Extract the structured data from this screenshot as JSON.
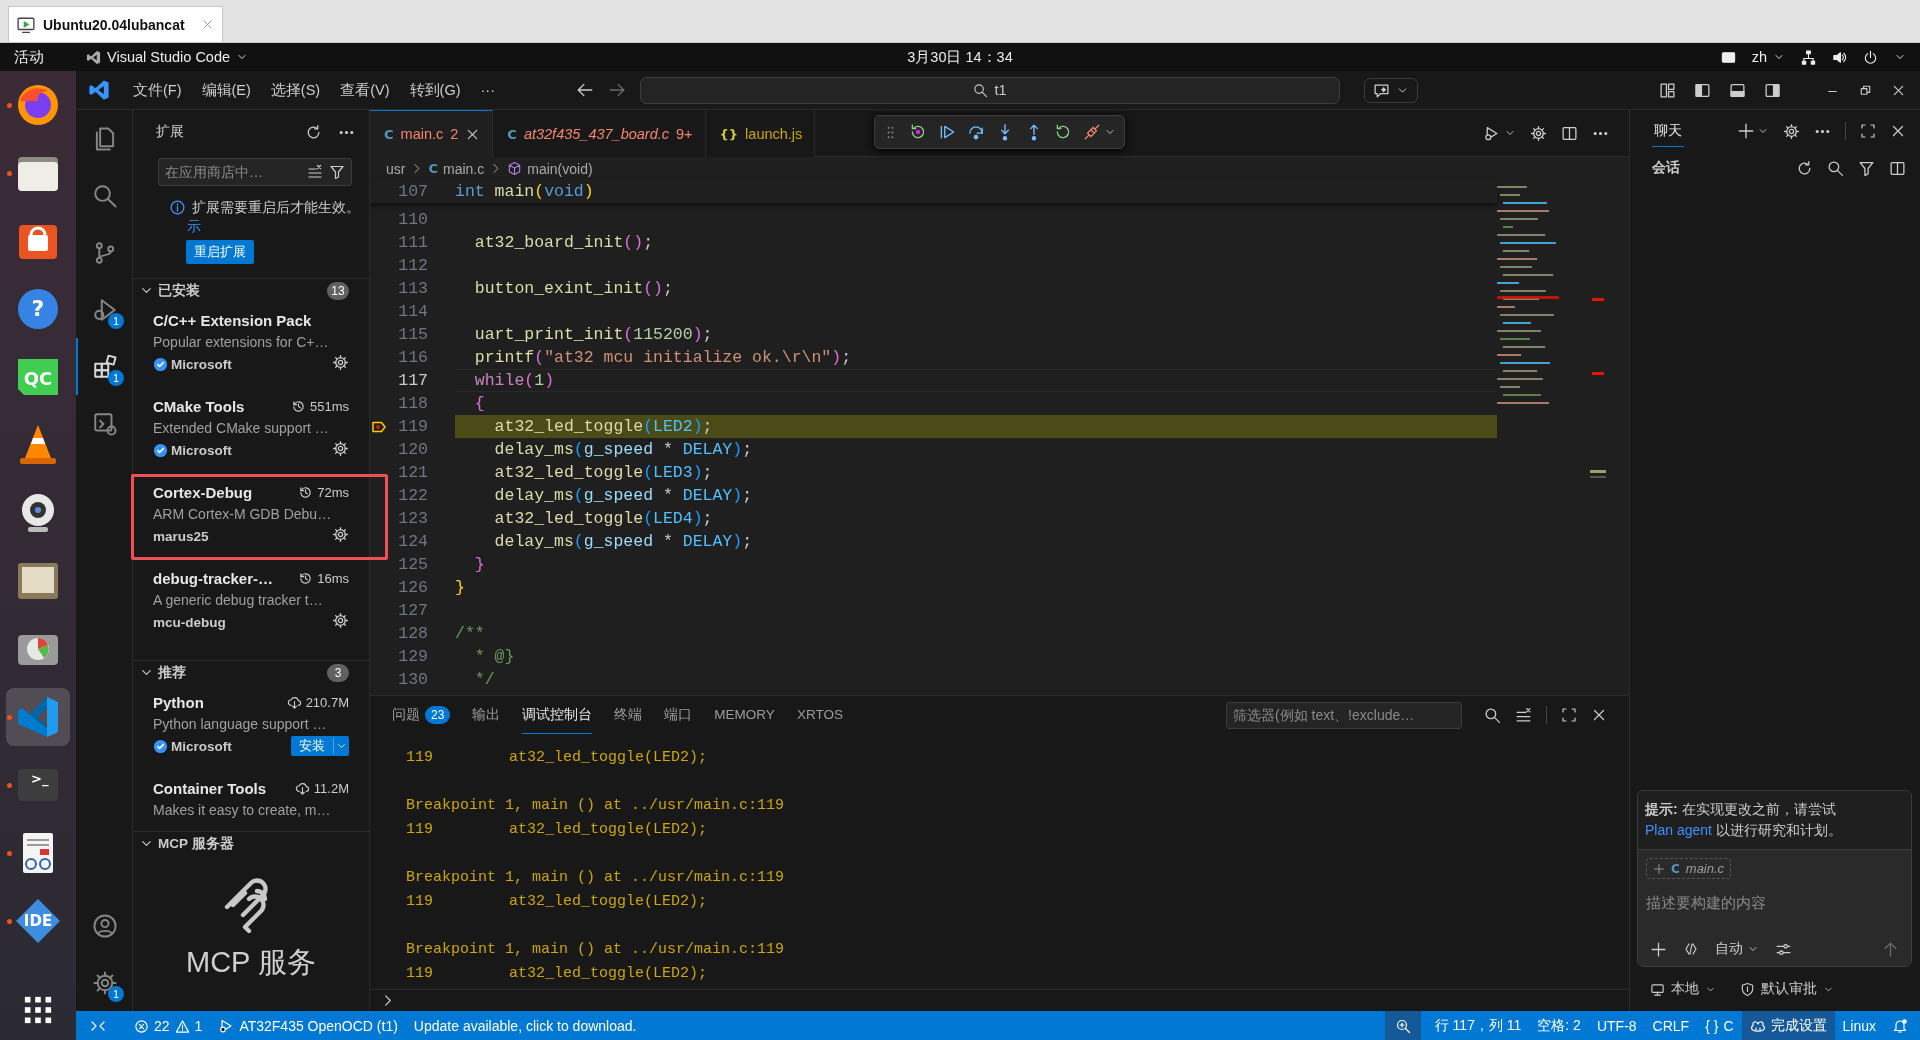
{
  "vm_tab": {
    "title": "Ubuntu20.04lubancat"
  },
  "top_bar": {
    "activities": "活动",
    "app": "Visual Studio Code",
    "clock": "3月30日 14：34",
    "input_method": "zh"
  },
  "dock": {
    "items": [
      {
        "kind": "browser",
        "running": true,
        "selected": false
      },
      {
        "kind": "files",
        "running": true,
        "selected": false
      },
      {
        "kind": "store",
        "running": false,
        "selected": false
      },
      {
        "kind": "help",
        "label": "?",
        "running": false,
        "selected": false
      },
      {
        "kind": "qc",
        "label": "QC",
        "running": false,
        "selected": false
      },
      {
        "kind": "cone",
        "running": false,
        "selected": false
      },
      {
        "kind": "webcam",
        "running": false,
        "selected": false
      },
      {
        "kind": "drawer",
        "running": false,
        "selected": false
      },
      {
        "kind": "disk",
        "running": false,
        "selected": false
      },
      {
        "kind": "code",
        "running": true,
        "selected": true
      },
      {
        "kind": "terminal",
        "label": ">_",
        "running": true,
        "selected": false
      },
      {
        "kind": "viewer",
        "running": true,
        "selected": false
      },
      {
        "kind": "ide",
        "label": "IDE",
        "running": true,
        "selected": false
      }
    ]
  },
  "title_bar": {
    "menus": [
      "文件(F)",
      "编辑(E)",
      "选择(S)",
      "查看(V)",
      "转到(G)",
      "···"
    ],
    "search": "t1"
  },
  "activity_bar": {
    "items": [
      {
        "kind": "explorer",
        "selected": false
      },
      {
        "kind": "search",
        "selected": false
      },
      {
        "kind": "source-control",
        "selected": false
      },
      {
        "kind": "debug",
        "badge": "1",
        "selected": false
      },
      {
        "kind": "extensions",
        "badge": "1",
        "selected": true
      },
      {
        "kind": "remote",
        "selected": false
      }
    ],
    "bottom": [
      {
        "kind": "account"
      },
      {
        "kind": "settings",
        "badge": "1"
      }
    ]
  },
  "sidebar": {
    "title": "扩展",
    "search": {
      "placeholder": "在应用商店中…"
    },
    "notice": {
      "text": "扩展需要重启后才能生效。",
      "link": "示",
      "button": "重启扩展"
    },
    "sections": [
      {
        "title": "已安装",
        "count": "13",
        "expanded": true,
        "items": [
          {
            "name": "C/C++ Extension Pack",
            "description": "Popular extensions for C+…",
            "publisher": "Microsoft",
            "verified": true,
            "highlighted": false
          },
          {
            "name": "CMake Tools",
            "metric": {
              "kind": "startup",
              "text": "551ms"
            },
            "description": "Extended CMake support …",
            "publisher": "Microsoft",
            "verified": true,
            "highlighted": false
          },
          {
            "name": "Cortex-Debug",
            "metric": {
              "kind": "startup",
              "text": "72ms"
            },
            "description": "ARM Cortex-M GDB Debu…",
            "publisher": "marus25",
            "verified": false,
            "highlighted": true
          },
          {
            "name": "debug-tracker-…",
            "metric": {
              "kind": "startup",
              "text": "16ms"
            },
            "description": "A generic debug tracker t…",
            "publisher": "mcu-debug",
            "verified": false,
            "highlighted": false
          }
        ]
      },
      {
        "title": "推荐",
        "count": "3",
        "expanded": true,
        "items": [
          {
            "name": "Python",
            "metric": {
              "kind": "downloads",
              "text": "210.7M"
            },
            "description": "Python language support …",
            "publisher": "Microsoft",
            "verified": true,
            "install": "安装",
            "highlighted": false
          },
          {
            "name": "Container Tools",
            "metric": {
              "kind": "downloads",
              "text": "11.2M"
            },
            "description": "Makes it easy to create, m…",
            "highlighted": false
          }
        ]
      },
      {
        "title": "MCP 服务器",
        "expanded": true,
        "banner": "MCP 服务"
      }
    ]
  },
  "editor": {
    "tabs": [
      {
        "icon": "C",
        "label": "main.c",
        "problems": "2",
        "kind": "error",
        "selected": true,
        "preview": false
      },
      {
        "icon": "C",
        "label": "at32f435_437_board.c",
        "problems": "9+",
        "kind": "error",
        "selected": false,
        "preview": true
      },
      {
        "icon": "{}",
        "label": "launch.js",
        "kind": "warning",
        "selected": false,
        "preview": false
      }
    ],
    "breadcrumbs": [
      {
        "kind": "folder",
        "text": "usr"
      },
      {
        "kind": "file",
        "icon": "C",
        "text": "main.c"
      },
      {
        "kind": "symbol",
        "text": "main(void)"
      }
    ],
    "sticky": {
      "number": "107",
      "tokens": [
        {
          "kind": "keyword",
          "text": "int"
        },
        {
          "kind": "function",
          "text": " main"
        },
        {
          "kind": "bracket1",
          "text": "("
        },
        {
          "kind": "keyword",
          "text": "void"
        },
        {
          "kind": "bracket1",
          "text": ")"
        }
      ]
    },
    "lines": [
      {
        "number": "110",
        "current": false,
        "paused": false
      },
      {
        "number": "111",
        "current": false,
        "paused": false,
        "tokens": [
          {
            "kind": "function",
            "text": "  at32_board_init"
          },
          {
            "kind": "bracket2",
            "text": "()"
          },
          {
            "kind": "plain",
            "text": ";"
          }
        ]
      },
      {
        "number": "112",
        "current": false,
        "paused": false
      },
      {
        "number": "113",
        "current": false,
        "paused": false,
        "tokens": [
          {
            "kind": "function",
            "text": "  button_exint_init"
          },
          {
            "kind": "bracket2",
            "text": "()"
          },
          {
            "kind": "plain",
            "text": ";"
          }
        ]
      },
      {
        "number": "114",
        "current": false,
        "paused": false
      },
      {
        "number": "115",
        "current": false,
        "paused": false,
        "tokens": [
          {
            "kind": "function",
            "text": "  uart_print_init"
          },
          {
            "kind": "bracket2",
            "text": "("
          },
          {
            "kind": "number",
            "text": "115200"
          },
          {
            "kind": "bracket2",
            "text": ")"
          },
          {
            "kind": "plain",
            "text": ";"
          }
        ]
      },
      {
        "number": "116",
        "current": false,
        "paused": false,
        "tokens": [
          {
            "kind": "function",
            "text": "  printf"
          },
          {
            "kind": "bracket2",
            "text": "("
          },
          {
            "kind": "string",
            "text": "\"at32 mcu initialize ok.\\r\\n\""
          },
          {
            "kind": "bracket2",
            "text": ")"
          },
          {
            "kind": "plain",
            "text": ";"
          }
        ]
      },
      {
        "number": "117",
        "current": true,
        "paused": false,
        "tokens": [
          {
            "kind": "control",
            "text": "  while"
          },
          {
            "kind": "bracket2",
            "text": "("
          },
          {
            "kind": "number",
            "text": "1"
          },
          {
            "kind": "bracket2",
            "text": ")"
          }
        ]
      },
      {
        "number": "118",
        "current": false,
        "paused": false,
        "tokens": [
          {
            "kind": "bracket2",
            "text": "  {"
          }
        ]
      },
      {
        "number": "119",
        "current": false,
        "paused": true,
        "tokens": [
          {
            "kind": "function",
            "text": "    at32_led_toggle"
          },
          {
            "kind": "bracket3",
            "text": "("
          },
          {
            "kind": "constant",
            "text": "LED2"
          },
          {
            "kind": "bracket3",
            "text": ")"
          },
          {
            "kind": "plain",
            "text": ";"
          }
        ]
      },
      {
        "number": "120",
        "current": false,
        "paused": false,
        "tokens": [
          {
            "kind": "function",
            "text": "    delay_ms"
          },
          {
            "kind": "bracket3",
            "text": "("
          },
          {
            "kind": "variable",
            "text": "g_speed"
          },
          {
            "kind": "plain",
            "text": " * "
          },
          {
            "kind": "constant",
            "text": "DELAY"
          },
          {
            "kind": "bracket3",
            "text": ")"
          },
          {
            "kind": "plain",
            "text": ";"
          }
        ]
      },
      {
        "number": "121",
        "current": false,
        "paused": false,
        "tokens": [
          {
            "kind": "function",
            "text": "    at32_led_toggle"
          },
          {
            "kind": "bracket3",
            "text": "("
          },
          {
            "kind": "constant",
            "text": "LED3"
          },
          {
            "kind": "bracket3",
            "text": ")"
          },
          {
            "kind": "plain",
            "text": ";"
          }
        ]
      },
      {
        "number": "122",
        "current": false,
        "paused": false,
        "tokens": [
          {
            "kind": "function",
            "text": "    delay_ms"
          },
          {
            "kind": "bracket3",
            "text": "("
          },
          {
            "kind": "variable",
            "text": "g_speed"
          },
          {
            "kind": "plain",
            "text": " * "
          },
          {
            "kind": "constant",
            "text": "DELAY"
          },
          {
            "kind": "bracket3",
            "text": ")"
          },
          {
            "kind": "plain",
            "text": ";"
          }
        ]
      },
      {
        "number": "123",
        "current": false,
        "paused": false,
        "tokens": [
          {
            "kind": "function",
            "text": "    at32_led_toggle"
          },
          {
            "kind": "bracket3",
            "text": "("
          },
          {
            "kind": "constant",
            "text": "LED4"
          },
          {
            "kind": "bracket3",
            "text": ")"
          },
          {
            "kind": "plain",
            "text": ";"
          }
        ]
      },
      {
        "number": "124",
        "current": false,
        "paused": false,
        "tokens": [
          {
            "kind": "function",
            "text": "    delay_ms"
          },
          {
            "kind": "bracket3",
            "text": "("
          },
          {
            "kind": "variable",
            "text": "g_speed"
          },
          {
            "kind": "plain",
            "text": " * "
          },
          {
            "kind": "constant",
            "text": "DELAY"
          },
          {
            "kind": "bracket3",
            "text": ")"
          },
          {
            "kind": "plain",
            "text": ";"
          }
        ]
      },
      {
        "number": "125",
        "current": false,
        "paused": false,
        "tokens": [
          {
            "kind": "bracket2",
            "text": "  }"
          }
        ]
      },
      {
        "number": "126",
        "current": false,
        "paused": false,
        "tokens": [
          {
            "kind": "bracket1",
            "text": "}"
          }
        ]
      },
      {
        "number": "127",
        "current": false,
        "paused": false
      },
      {
        "number": "128",
        "current": false,
        "paused": false,
        "tokens": [
          {
            "kind": "comment",
            "text": "/**"
          }
        ]
      },
      {
        "number": "129",
        "current": false,
        "paused": false,
        "tokens": [
          {
            "kind": "comment",
            "text": "  * @}"
          }
        ]
      },
      {
        "number": "130",
        "current": false,
        "paused": false,
        "tokens": [
          {
            "kind": "comment",
            "text": "  */"
          }
        ]
      }
    ]
  },
  "panel": {
    "tabs": [
      {
        "label": "问题",
        "badge": "23",
        "selected": false
      },
      {
        "label": "输出",
        "selected": false
      },
      {
        "label": "调试控制台",
        "selected": true
      },
      {
        "label": "终端",
        "selected": false
      },
      {
        "label": "端口",
        "selected": false
      },
      {
        "label": "MEMORY",
        "selected": false
      },
      {
        "label": "XRTOS",
        "selected": false
      }
    ],
    "filter": {
      "placeholder": "筛选器(例如 text、!exclude…"
    },
    "output": [
      {
        "kind": "source",
        "line": "119",
        "text": "at32_led_toggle(LED2);"
      },
      {
        "kind": "breakpoint",
        "text": "Breakpoint 1, main () at ../usr/main.c:119"
      },
      {
        "kind": "source",
        "line": "119",
        "text": "at32_led_toggle(LED2);"
      },
      {
        "kind": "breakpoint",
        "text": "Breakpoint 1, main () at ../usr/main.c:119"
      },
      {
        "kind": "source",
        "line": "119",
        "text": "at32_led_toggle(LED2);"
      },
      {
        "kind": "breakpoint",
        "text": "Breakpoint 1, main () at ../usr/main.c:119"
      },
      {
        "kind": "source",
        "line": "119",
        "text": "at32_led_toggle(LED2);"
      }
    ]
  },
  "chat": {
    "tabs": [
      {
        "label": "聊天",
        "selected": true
      }
    ],
    "section": "会话",
    "tip": {
      "text": "**提示:** 在实现更改之前，请尝试 ",
      "link": "Plan agent",
      "after": " 以进行研究和计划。"
    },
    "context": {
      "icon": "C",
      "file": "main.c"
    },
    "input": {
      "placeholder": "描述要构建的内容"
    },
    "mode": "自动",
    "footer": [
      "本地",
      "默认审批"
    ]
  },
  "status_bar": {
    "errors": "22",
    "warnings": "1",
    "debug": "AT32F435 OpenOCD (t1)",
    "message": "Update available, click to download.",
    "position": "行 117，列 11",
    "indent": "空格: 2",
    "encoding": "UTF-8",
    "eol": "CRLF",
    "language_icon": "{ }",
    "language": "C",
    "copilot": "完成设置",
    "os": "Linux"
  }
}
